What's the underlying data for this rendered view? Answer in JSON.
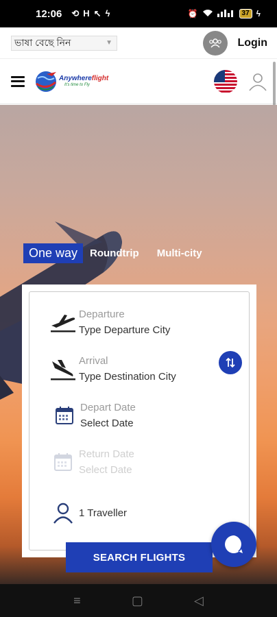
{
  "status": {
    "time": "12:06",
    "battery": "37"
  },
  "langbar": {
    "language_select": "ভাষা বেছে নিন",
    "login": "Login"
  },
  "header": {
    "logo_name_a": "Anywhere",
    "logo_name_b": "flight",
    "logo_tagline": "It's time to Fly"
  },
  "trip_tabs": {
    "one_way": "One way",
    "roundtrip": "Roundtrip",
    "multi_city": "Multi-city"
  },
  "form": {
    "departure": {
      "label": "Departure",
      "value": "Type Departure City"
    },
    "arrival": {
      "label": "Arrival",
      "value": "Type Destination City"
    },
    "depart_date": {
      "label": "Depart Date",
      "value": "Select Date"
    },
    "return_date": {
      "label": "Return Date",
      "value": "Select Date"
    },
    "travellers": "1 Traveller",
    "search_button": "SEARCH FLIGHTS"
  },
  "colors": {
    "accent": "#1f3fb5",
    "sky_top": "#b9a6a2",
    "sky_bottom": "#e47b3a"
  },
  "icons": [
    "group-icon",
    "hamburger-icon",
    "globe-logo-icon",
    "us-flag-icon",
    "user-icon",
    "takeoff-icon",
    "landing-icon",
    "calendar-icon",
    "swap-icon",
    "traveller-icon",
    "chat-icon"
  ]
}
